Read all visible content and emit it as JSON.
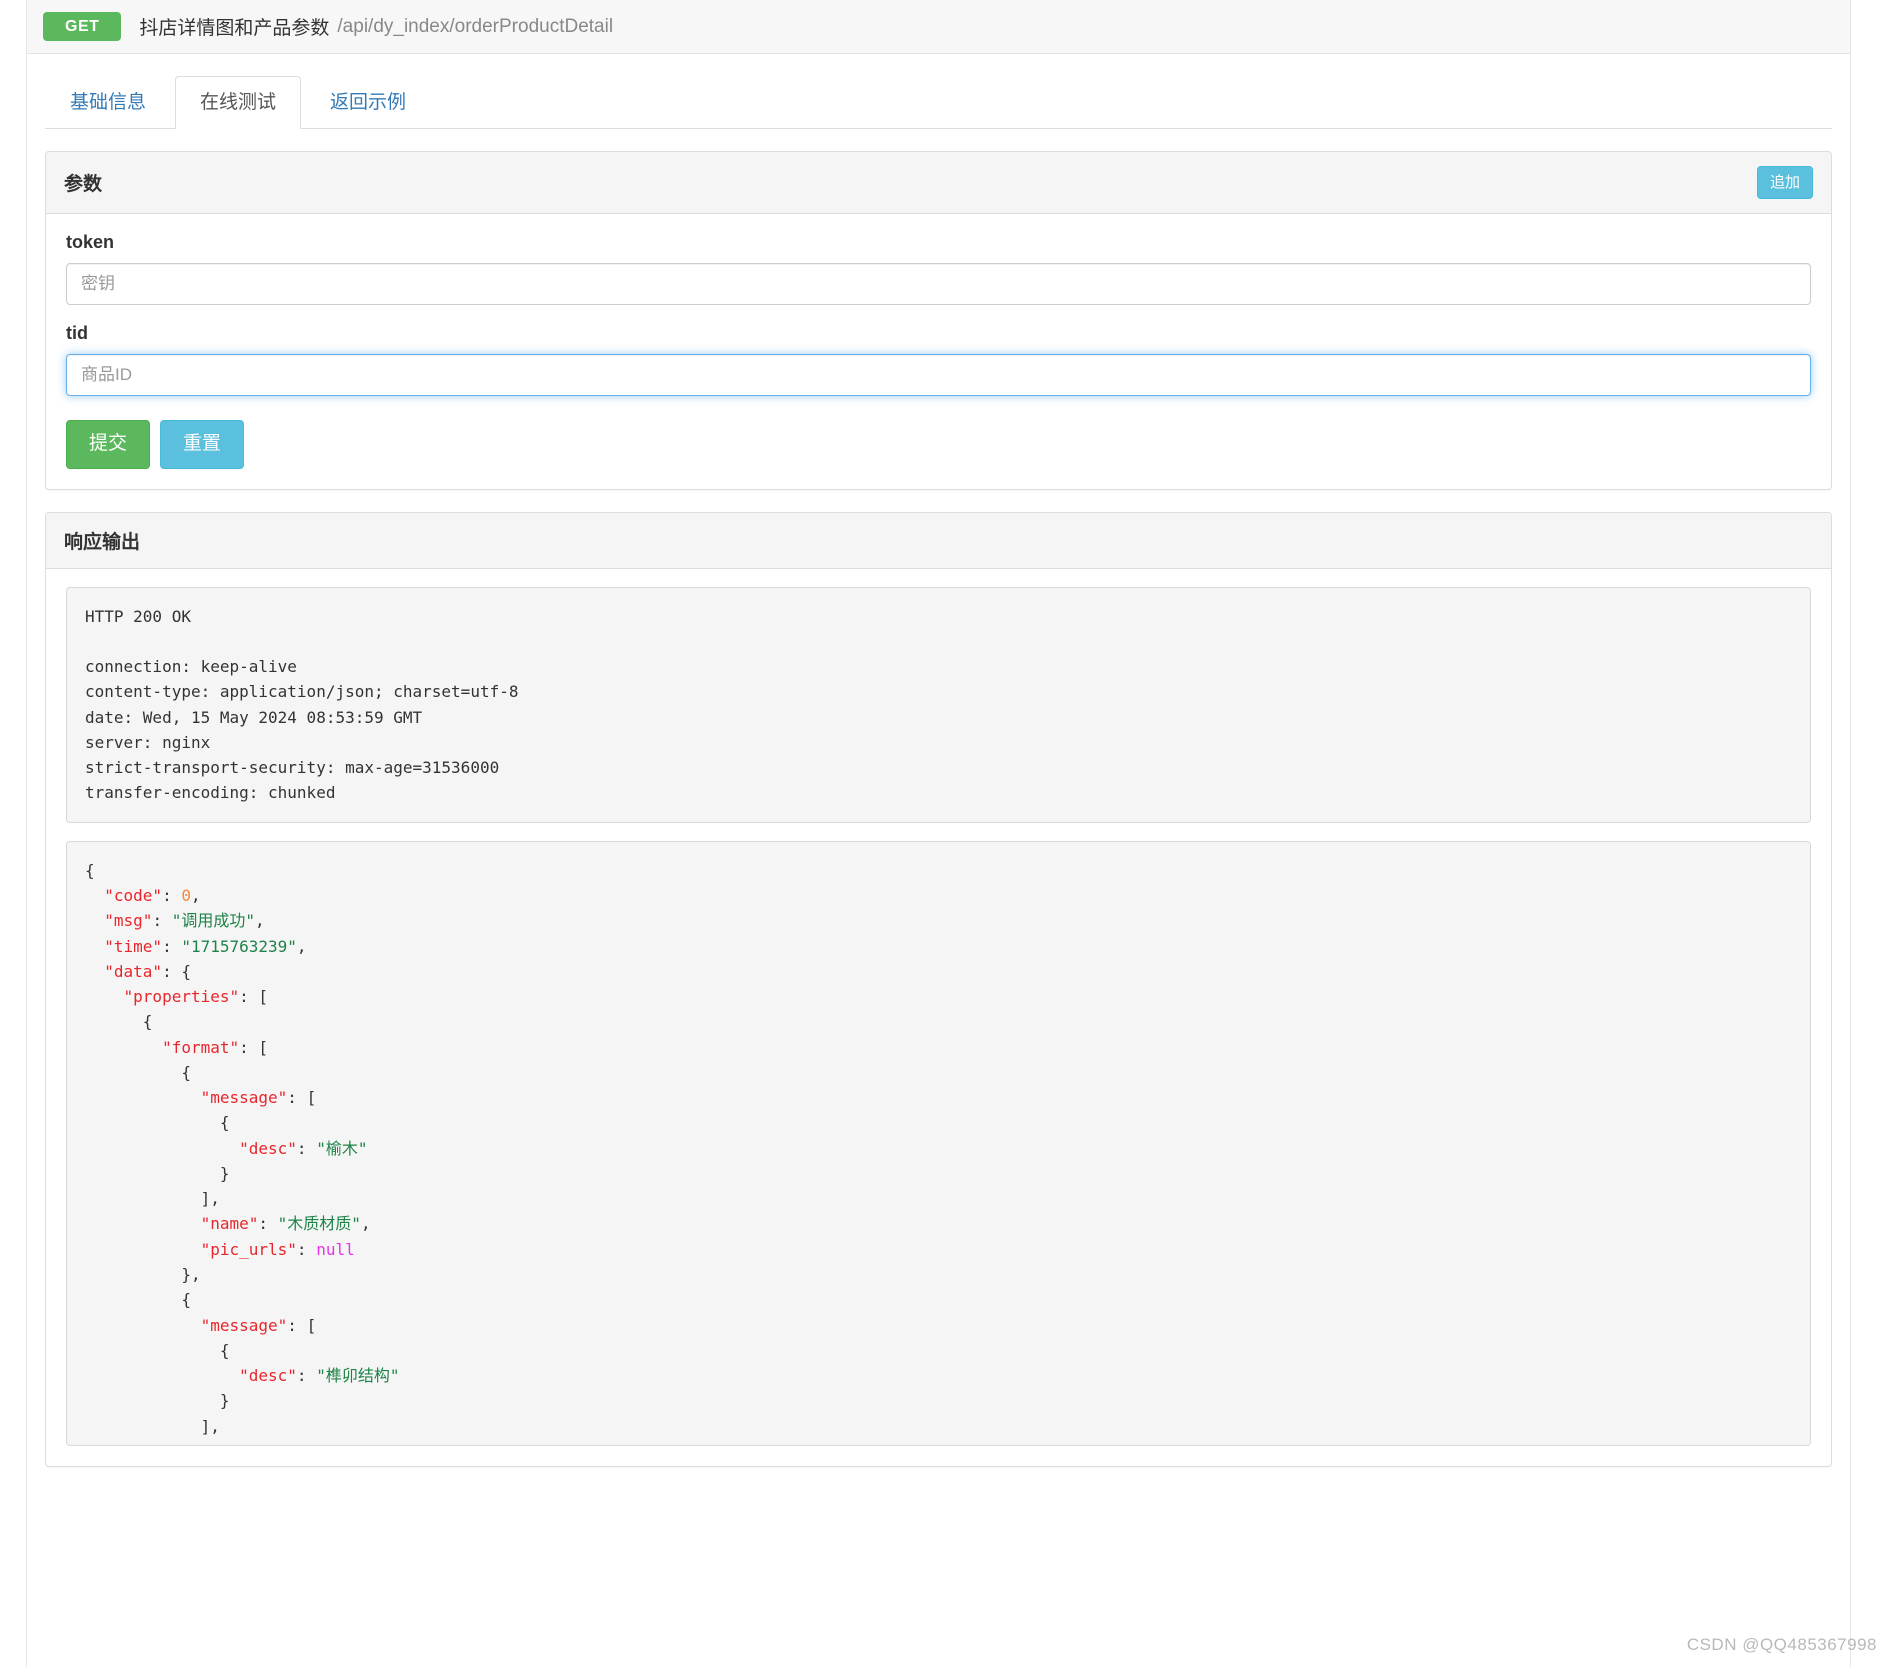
{
  "api": {
    "method": "GET",
    "title": "抖店详情图和产品参数",
    "path": "/api/dy_index/orderProductDetail"
  },
  "tabs": [
    {
      "label": "基础信息",
      "active": false
    },
    {
      "label": "在线测试",
      "active": true
    },
    {
      "label": "返回示例",
      "active": false
    }
  ],
  "params_panel": {
    "title": "参数",
    "add_button": "追加",
    "fields": [
      {
        "label": "token",
        "value": "",
        "placeholder": "密钥",
        "focused": false
      },
      {
        "label": "tid",
        "value": "",
        "placeholder": "商品ID",
        "focused": true
      }
    ],
    "submit_button": "提交",
    "reset_button": "重置"
  },
  "response_panel": {
    "title": "响应输出",
    "headers_text": "HTTP 200 OK\n\nconnection: keep-alive\ncontent-type: application/json; charset=utf-8\ndate: Wed, 15 May 2024 08:53:59 GMT\nserver: nginx\nstrict-transport-security: max-age=31536000\ntransfer-encoding: chunked",
    "json_lines": [
      [
        {
          "t": "{",
          "c": "pun"
        }
      ],
      [
        {
          "t": "  ",
          "c": "pun"
        },
        {
          "t": "\"code\"",
          "c": "key"
        },
        {
          "t": ": ",
          "c": "pun"
        },
        {
          "t": "0",
          "c": "num"
        },
        {
          "t": ",",
          "c": "pun"
        }
      ],
      [
        {
          "t": "  ",
          "c": "pun"
        },
        {
          "t": "\"msg\"",
          "c": "key"
        },
        {
          "t": ": ",
          "c": "pun"
        },
        {
          "t": "\"调用成功\"",
          "c": "str"
        },
        {
          "t": ",",
          "c": "pun"
        }
      ],
      [
        {
          "t": "  ",
          "c": "pun"
        },
        {
          "t": "\"time\"",
          "c": "key"
        },
        {
          "t": ": ",
          "c": "pun"
        },
        {
          "t": "\"1715763239\"",
          "c": "str"
        },
        {
          "t": ",",
          "c": "pun"
        }
      ],
      [
        {
          "t": "  ",
          "c": "pun"
        },
        {
          "t": "\"data\"",
          "c": "key"
        },
        {
          "t": ": {",
          "c": "pun"
        }
      ],
      [
        {
          "t": "    ",
          "c": "pun"
        },
        {
          "t": "\"properties\"",
          "c": "key"
        },
        {
          "t": ": [",
          "c": "pun"
        }
      ],
      [
        {
          "t": "      {",
          "c": "pun"
        }
      ],
      [
        {
          "t": "        ",
          "c": "pun"
        },
        {
          "t": "\"format\"",
          "c": "key"
        },
        {
          "t": ": [",
          "c": "pun"
        }
      ],
      [
        {
          "t": "          {",
          "c": "pun"
        }
      ],
      [
        {
          "t": "            ",
          "c": "pun"
        },
        {
          "t": "\"message\"",
          "c": "key"
        },
        {
          "t": ": [",
          "c": "pun"
        }
      ],
      [
        {
          "t": "              {",
          "c": "pun"
        }
      ],
      [
        {
          "t": "                ",
          "c": "pun"
        },
        {
          "t": "\"desc\"",
          "c": "key"
        },
        {
          "t": ": ",
          "c": "pun"
        },
        {
          "t": "\"榆木\"",
          "c": "str"
        }
      ],
      [
        {
          "t": "              }",
          "c": "pun"
        }
      ],
      [
        {
          "t": "            ],",
          "c": "pun"
        }
      ],
      [
        {
          "t": "            ",
          "c": "pun"
        },
        {
          "t": "\"name\"",
          "c": "key"
        },
        {
          "t": ": ",
          "c": "pun"
        },
        {
          "t": "\"木质材质\"",
          "c": "str"
        },
        {
          "t": ",",
          "c": "pun"
        }
      ],
      [
        {
          "t": "            ",
          "c": "pun"
        },
        {
          "t": "\"pic_urls\"",
          "c": "key"
        },
        {
          "t": ": ",
          "c": "pun"
        },
        {
          "t": "null",
          "c": "null"
        }
      ],
      [
        {
          "t": "          },",
          "c": "pun"
        }
      ],
      [
        {
          "t": "          {",
          "c": "pun"
        }
      ],
      [
        {
          "t": "            ",
          "c": "pun"
        },
        {
          "t": "\"message\"",
          "c": "key"
        },
        {
          "t": ": [",
          "c": "pun"
        }
      ],
      [
        {
          "t": "              {",
          "c": "pun"
        }
      ],
      [
        {
          "t": "                ",
          "c": "pun"
        },
        {
          "t": "\"desc\"",
          "c": "key"
        },
        {
          "t": ": ",
          "c": "pun"
        },
        {
          "t": "\"榫卯结构\"",
          "c": "str"
        }
      ],
      [
        {
          "t": "              }",
          "c": "pun"
        }
      ],
      [
        {
          "t": "            ],",
          "c": "pun"
        }
      ]
    ]
  },
  "watermark": "CSDN @QQ485367998",
  "colors": {
    "method_green": "#5cb85c",
    "info_blue": "#5bc0de",
    "link_blue": "#337ab7",
    "focus_blue": "#66afe9"
  }
}
